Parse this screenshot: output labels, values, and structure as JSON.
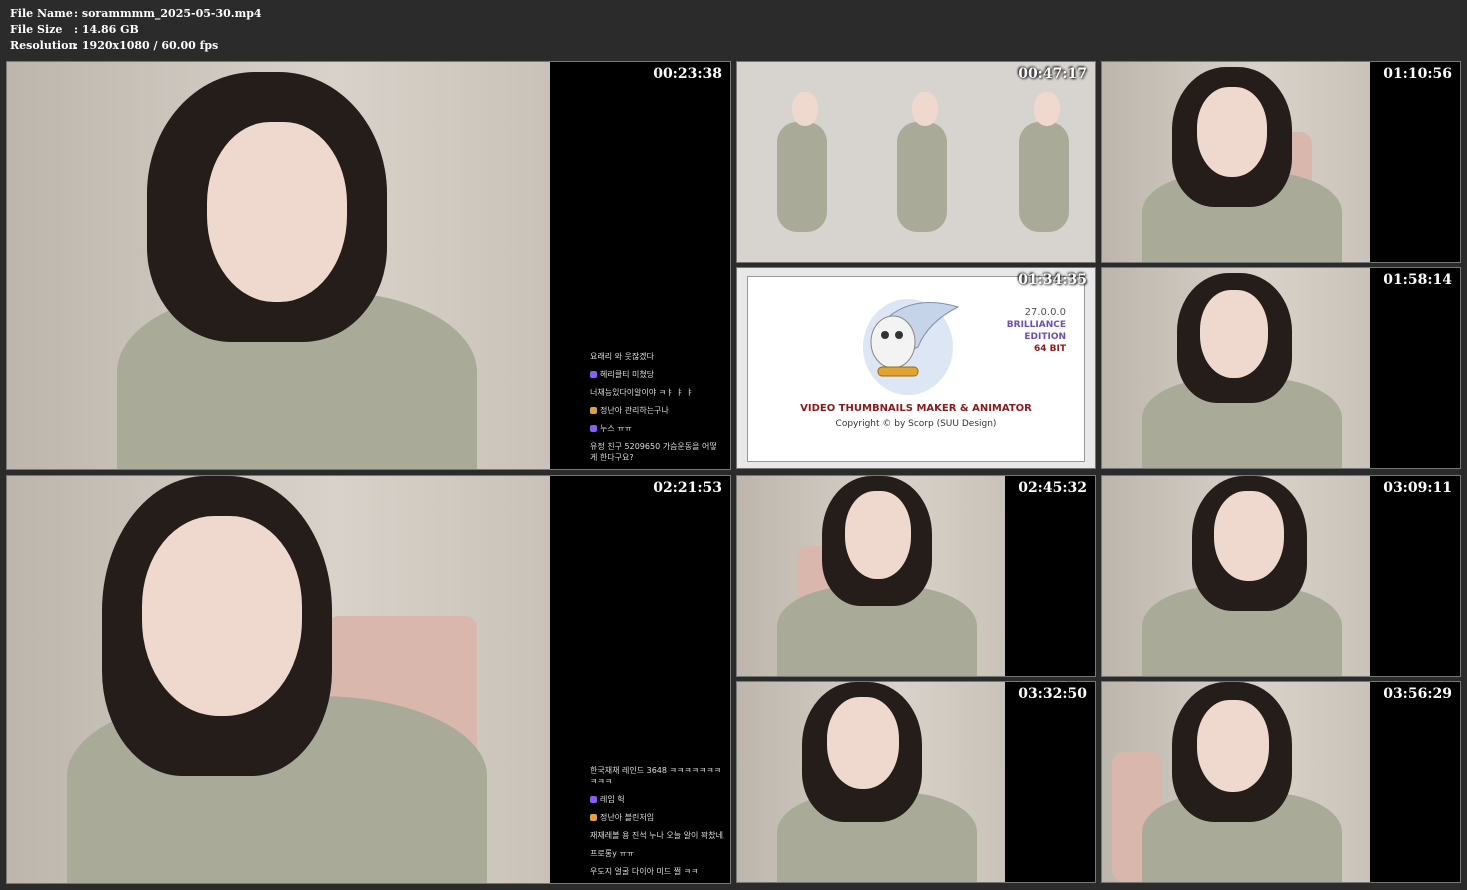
{
  "header": {
    "file_name_label": "File Name",
    "file_name_value": ":  sorammmm_2025-05-30.mp4",
    "file_size_label": "File Size",
    "file_size_value": ":  14.86 GB",
    "resolution_label": "Resolution",
    "resolution_value": ":  1920x1080 / 60.00 fps"
  },
  "tiles": [
    {
      "timestamp": "00:23:38"
    },
    {
      "timestamp": "00:47:17"
    },
    {
      "timestamp": "01:10:56"
    },
    {
      "timestamp": "01:34:35"
    },
    {
      "timestamp": "01:58:14"
    },
    {
      "timestamp": "02:21:53"
    },
    {
      "timestamp": "02:45:32"
    },
    {
      "timestamp": "03:09:11"
    },
    {
      "timestamp": "03:32:50"
    },
    {
      "timestamp": "03:56:29"
    }
  ],
  "chat1": [
    "요래리 와 웃잖겠다",
    "헤리클티 미쳤당",
    "너채능있다이알이야 ㅋㅑ ㅑ ㅑ",
    "정난아 관리하는구나",
    "누스 ㅠㅠ",
    "유정 친구 5209650 가슴운동을 어떻게 한다구요?"
  ],
  "chat6": [
    "한국채채 레인드 3648 ㅋㅋㅋㅋㅋㅋㅋㅋㅋㅋ",
    "레임 헉",
    "정난아 블린저임",
    "재재레볼 용 진석 누나 오늘 알이 꽉찼네요",
    "프로롱y ㅠㅠ",
    "우도지 얼굴 다이아 미드 쩔 ㅋㅋ"
  ],
  "logo": {
    "version": "27.0.0.0",
    "edition_1": "BRILLIANCE",
    "edition_2": "EDITION",
    "bits": "64 BIT",
    "title": "VIDEO THUMBNAILS MAKER & ANIMATOR",
    "copyright": "Copyright © by Scorp (SUU Design)"
  }
}
